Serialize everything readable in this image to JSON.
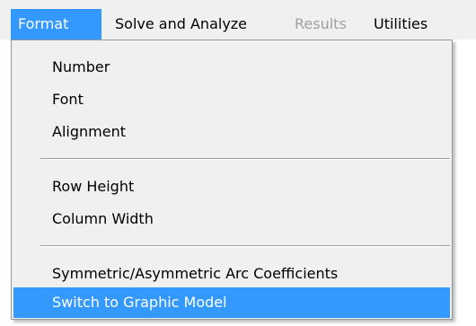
{
  "menubar": {
    "items": [
      {
        "label": "Format",
        "state": "open"
      },
      {
        "label": "Solve and Analyze",
        "state": "enabled"
      },
      {
        "label": "Results",
        "state": "disabled"
      },
      {
        "label": "Utilities",
        "state": "enabled"
      }
    ]
  },
  "format_menu": {
    "groups": [
      [
        "Number",
        "Font",
        "Alignment"
      ],
      [
        "Row Height",
        "Column Width"
      ],
      [
        "Symmetric/Asymmetric Arc Coefficients",
        "Switch to Graphic Model"
      ]
    ],
    "highlighted_item": "Switch to Graphic Model"
  },
  "colors": {
    "highlight": "#3399ff",
    "menu_background": "#f0f0f0",
    "disabled_text": "#a0a0a0"
  }
}
